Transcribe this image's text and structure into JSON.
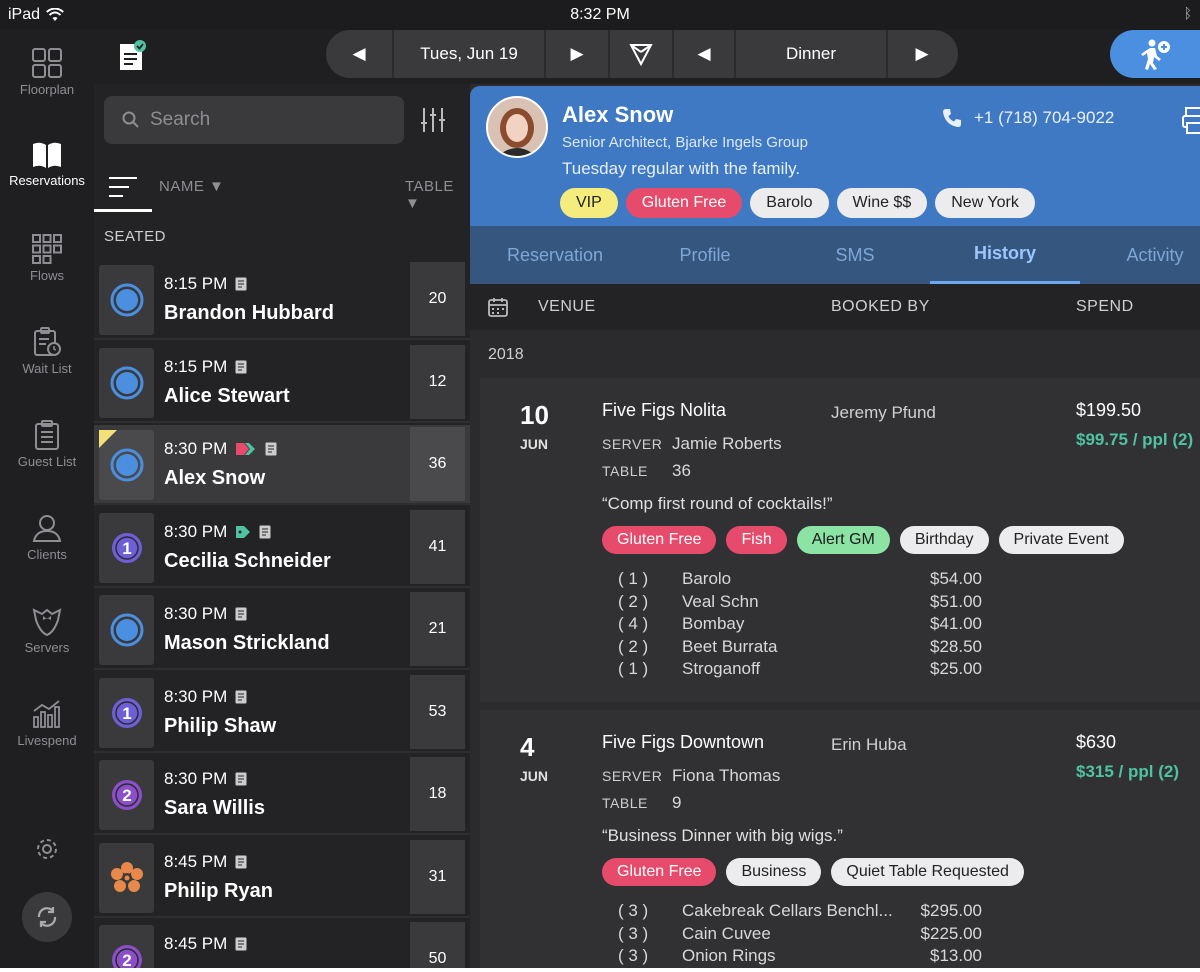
{
  "status_bar": {
    "device": "iPad",
    "time": "8:32 PM"
  },
  "rail": {
    "items": [
      {
        "label": "Floorplan",
        "icon": "floorplan-icon"
      },
      {
        "label": "Reservations",
        "icon": "book-icon"
      },
      {
        "label": "Flows",
        "icon": "flows-icon"
      },
      {
        "label": "Wait List",
        "icon": "waitlist-icon"
      },
      {
        "label": "Guest List",
        "icon": "guestlist-icon"
      },
      {
        "label": "Clients",
        "icon": "clients-icon"
      },
      {
        "label": "Servers",
        "icon": "servers-icon"
      },
      {
        "label": "Livespend",
        "icon": "livespend-icon"
      }
    ]
  },
  "toolbar": {
    "date": "Tues, Jun 19",
    "shift": "Dinner"
  },
  "list": {
    "search_placeholder": "Search",
    "col_name": "NAME",
    "col_table": "TABLE",
    "section": "SEATED",
    "reservations": [
      {
        "time": "8:15 PM",
        "name": "Brandon Hubbard",
        "table": "20",
        "status": "seated"
      },
      {
        "time": "8:15 PM",
        "name": "Alice Stewart",
        "table": "12",
        "status": "seated"
      },
      {
        "time": "8:30 PM",
        "name": "Alex Snow",
        "table": "36",
        "status": "seated"
      },
      {
        "time": "8:30 PM",
        "name": "Cecilia Schneider",
        "table": "41",
        "status": "course-1"
      },
      {
        "time": "8:30 PM",
        "name": "Mason Strickland",
        "table": "21",
        "status": "seated"
      },
      {
        "time": "8:30 PM",
        "name": "Philip Shaw",
        "table": "53",
        "status": "course-1"
      },
      {
        "time": "8:30 PM",
        "name": "Sara Willis",
        "table": "18",
        "status": "course-2"
      },
      {
        "time": "8:45 PM",
        "name": "Philip Ryan",
        "table": "31",
        "status": "dessert"
      },
      {
        "time": "8:45 PM",
        "name": "",
        "table": "50",
        "status": "course-2"
      }
    ],
    "status_labels": {
      "course-1": "1",
      "course-2": "2"
    }
  },
  "profile": {
    "name": "Alex Snow",
    "title": "Senior Architect, Bjarke Ingels Group",
    "note": "Tuesday regular with the family.",
    "phone": "+1 (718) 704-9022",
    "chips": [
      {
        "label": "VIP",
        "bg": "#f5ec7e",
        "fg": "#222222"
      },
      {
        "label": "Gluten Free",
        "bg": "#e74b6c",
        "fg": "#ffffff"
      },
      {
        "label": "Barolo",
        "bg": "#ececee",
        "fg": "#222222"
      },
      {
        "label": "Wine $$",
        "bg": "#ececee",
        "fg": "#222222"
      },
      {
        "label": "New York",
        "bg": "#ececee",
        "fg": "#222222"
      }
    ]
  },
  "tabs": [
    "Reservation",
    "Profile",
    "SMS",
    "History",
    "Activity"
  ],
  "active_tab": "History",
  "history": {
    "col_venue": "VENUE",
    "col_booked": "BOOKED BY",
    "col_spend": "SPEND",
    "year": "2018",
    "server_label": "SERVER",
    "table_label": "TABLE",
    "visits": [
      {
        "day": "10",
        "month": "JUN",
        "venue": "Five Figs Nolita",
        "booked_by": "Jeremy Pfund",
        "spend": "$199.50",
        "per_person": "$99.75 / ppl (2)",
        "server": "Jamie Roberts",
        "table": "36",
        "note": "“Comp first round of cocktails!”",
        "tags": [
          {
            "label": "Gluten Free",
            "bg": "#e74b6c",
            "fg": "#ffffff"
          },
          {
            "label": "Fish",
            "bg": "#e74b6c",
            "fg": "#ffffff"
          },
          {
            "label": "Alert GM",
            "bg": "#8be3a4",
            "fg": "#1a1a1a"
          },
          {
            "label": "Birthday",
            "bg": "#ececee",
            "fg": "#222222"
          },
          {
            "label": "Private Event",
            "bg": "#ececee",
            "fg": "#222222"
          }
        ],
        "items": [
          {
            "qty": "( 1 )",
            "item": "Barolo",
            "price": "$54.00"
          },
          {
            "qty": "( 2 )",
            "item": "Veal Schn",
            "price": "$51.00"
          },
          {
            "qty": "( 4 )",
            "item": "Bombay",
            "price": "$41.00"
          },
          {
            "qty": "( 2 )",
            "item": "Beet Burrata",
            "price": "$28.50"
          },
          {
            "qty": "( 1 )",
            "item": "Stroganoff",
            "price": "$25.00"
          }
        ]
      },
      {
        "day": "4",
        "month": "JUN",
        "venue": "Five Figs Downtown",
        "booked_by": "Erin Huba",
        "spend": "$630",
        "per_person": "$315 / ppl (2)",
        "server": "Fiona Thomas",
        "table": "9",
        "note": "“Business Dinner with big wigs.”",
        "tags": [
          {
            "label": "Gluten Free",
            "bg": "#e74b6c",
            "fg": "#ffffff"
          },
          {
            "label": "Business",
            "bg": "#ececee",
            "fg": "#222222"
          },
          {
            "label": "Quiet Table Requested",
            "bg": "#ececee",
            "fg": "#222222"
          }
        ],
        "items": [
          {
            "qty": "( 3 )",
            "item": "Cakebreak Cellars Benchl...",
            "price": "$295.00"
          },
          {
            "qty": "( 3 )",
            "item": "Cain Cuvee",
            "price": "$225.00"
          },
          {
            "qty": "( 3 )",
            "item": "Onion Rings",
            "price": "$13.00"
          }
        ]
      }
    ]
  }
}
